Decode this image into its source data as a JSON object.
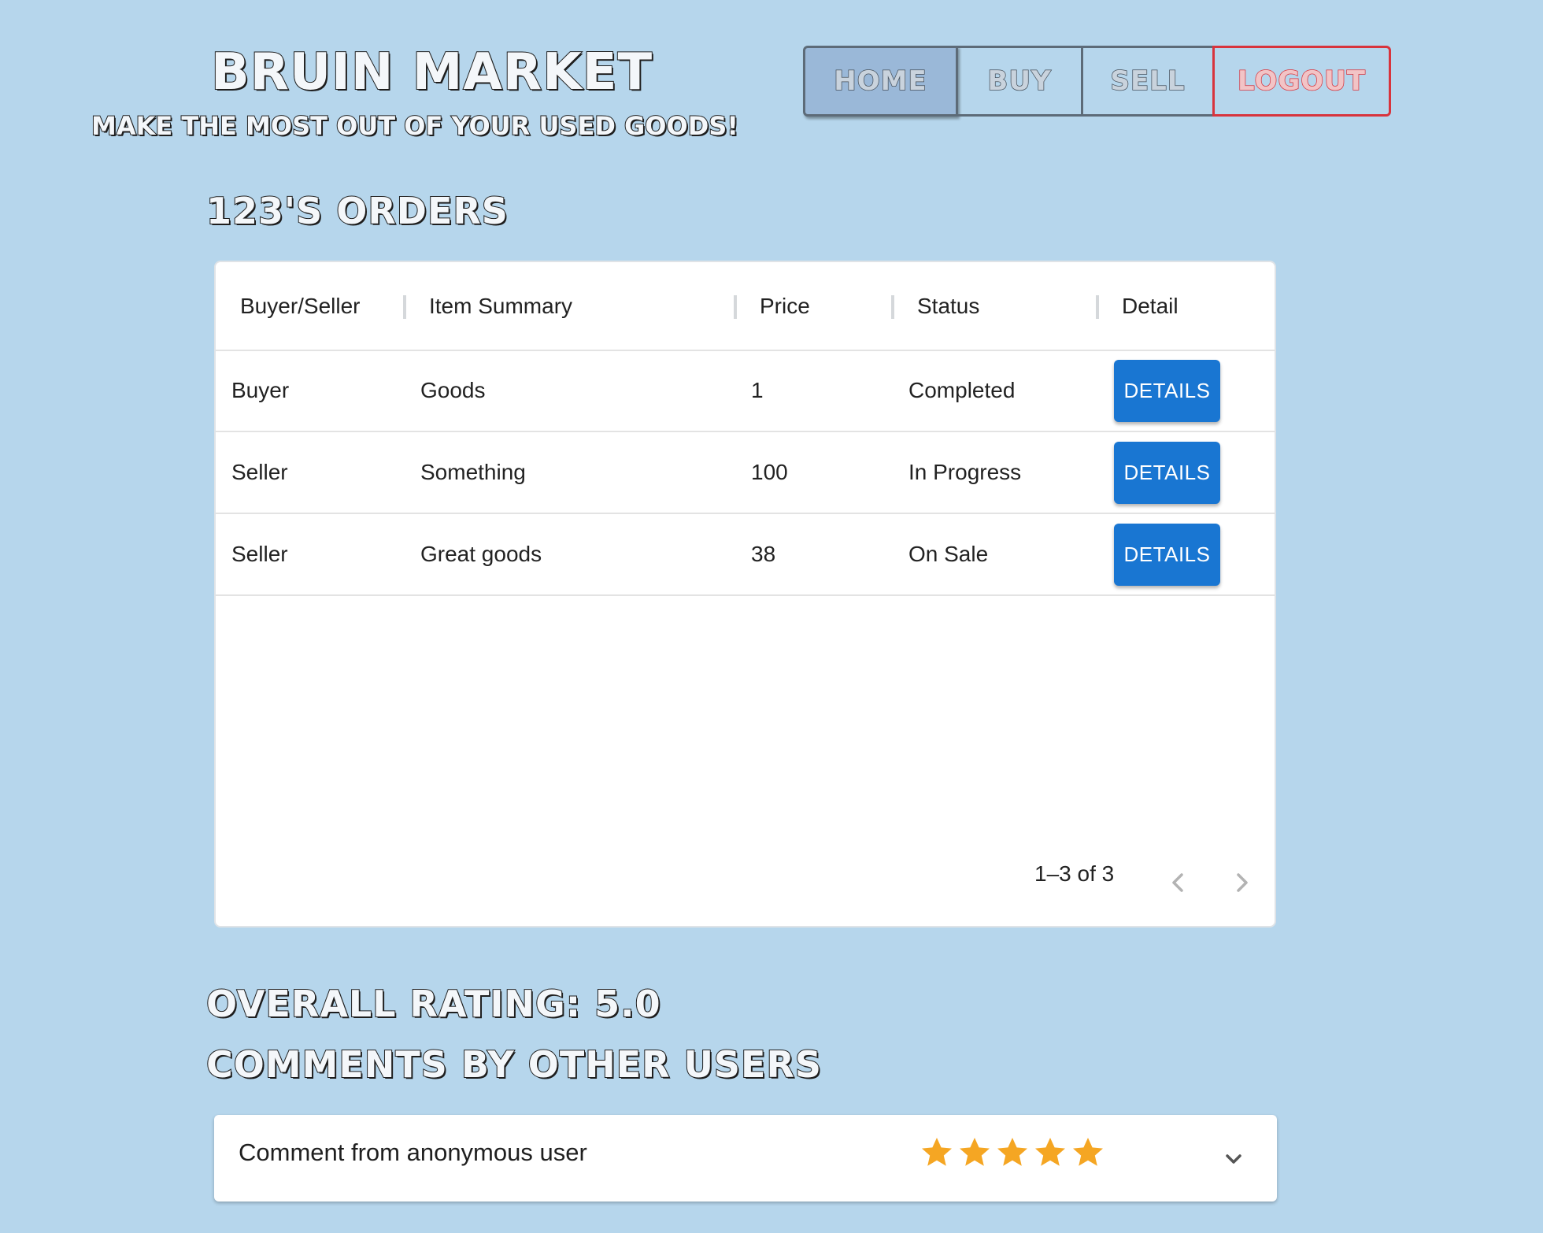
{
  "header": {
    "title": "Bruin Market",
    "tagline": "Make the most out of your used goods!"
  },
  "nav": {
    "home": "Home",
    "buy": "Buy",
    "sell": "Sell",
    "logout": "Logout"
  },
  "orders": {
    "title": "123's Orders",
    "columns": [
      "Buyer/Seller",
      "Item Summary",
      "Price",
      "Status",
      "Detail"
    ],
    "rows": [
      {
        "role": "Buyer",
        "item": "Goods",
        "price": "1",
        "status": "Completed",
        "action": "Details"
      },
      {
        "role": "Seller",
        "item": "Something",
        "price": "100",
        "status": "In Progress",
        "action": "Details"
      },
      {
        "role": "Seller",
        "item": "Great goods",
        "price": "38",
        "status": "On Sale",
        "action": "Details"
      }
    ],
    "pagination": "1–3 of 3"
  },
  "rating": {
    "title": "Overall Rating: 5.0"
  },
  "comments": {
    "title": "Comments by other users",
    "items": [
      {
        "text": "Comment from anonymous user",
        "stars": 5,
        "max_stars": 5
      }
    ]
  },
  "colors": {
    "background": "#b6d6ec",
    "primary_button": "#1976d2",
    "logout_accent": "#d8343d",
    "star": "#f5a623"
  },
  "icons": {
    "prev": "chevron-left-icon",
    "next": "chevron-right-icon",
    "expand": "chevron-down-icon",
    "star": "star-icon"
  }
}
